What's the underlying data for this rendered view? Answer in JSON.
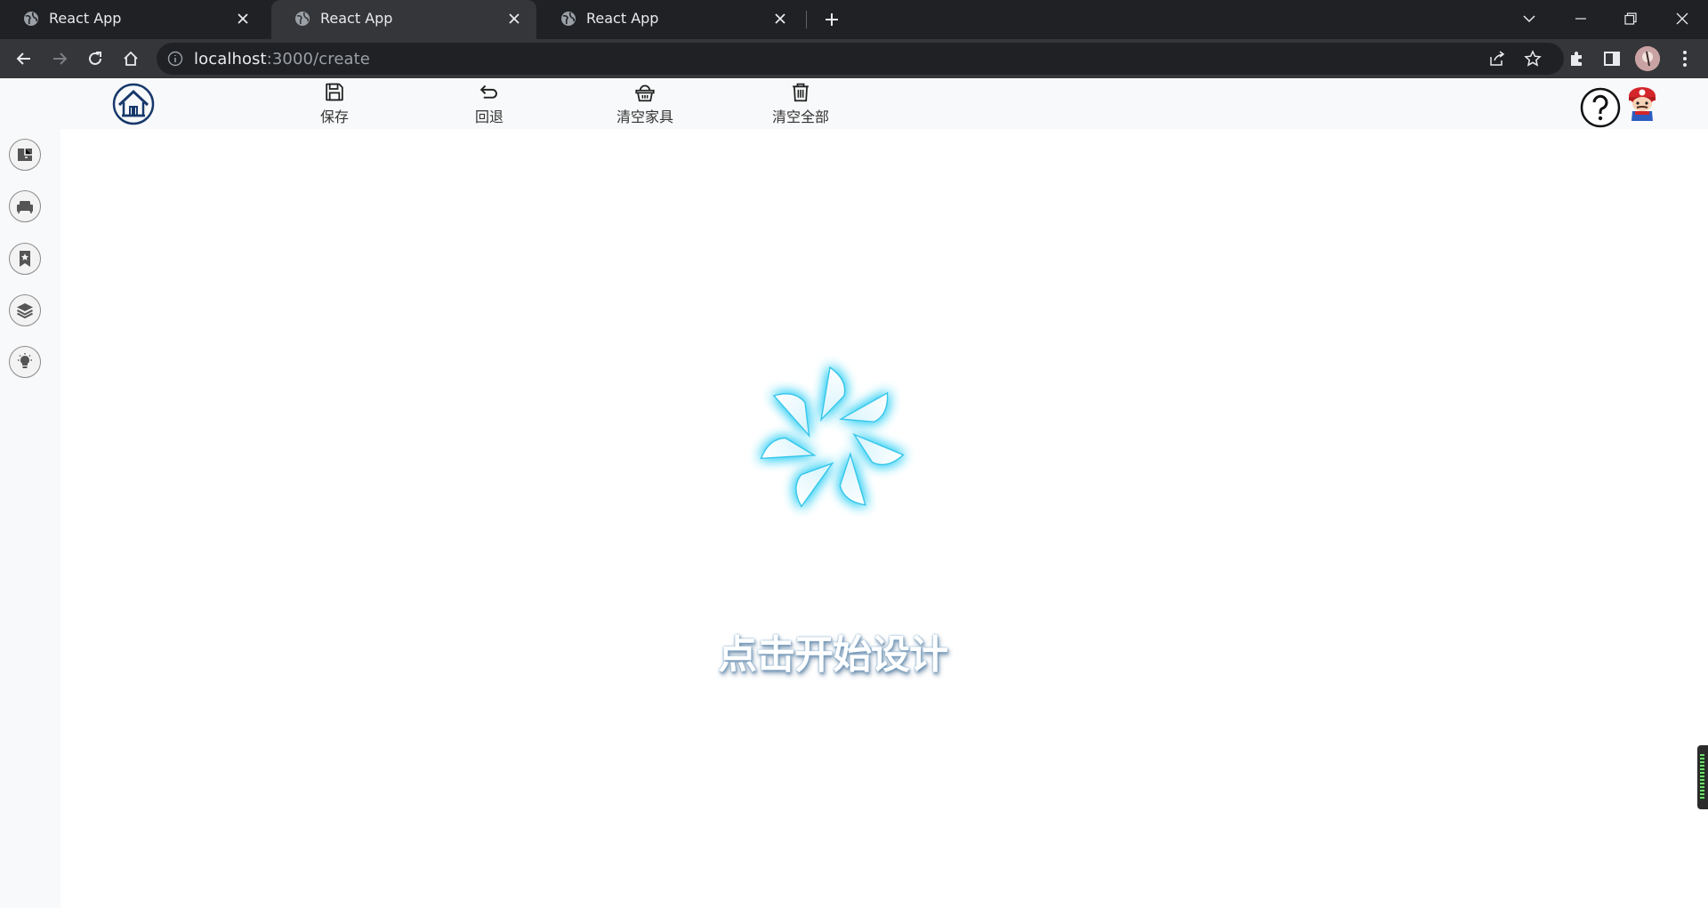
{
  "browser": {
    "tabs": [
      {
        "title": "React App",
        "active": false
      },
      {
        "title": "React App",
        "active": true
      },
      {
        "title": "React App",
        "active": false
      }
    ],
    "url_host": "localhost",
    "url_path": ":3000/create"
  },
  "header": {
    "tools": [
      {
        "label": "保存",
        "icon": "save-icon"
      },
      {
        "label": "回退",
        "icon": "undo-icon"
      },
      {
        "label": "清空家具",
        "icon": "basket-icon"
      },
      {
        "label": "清空全部",
        "icon": "trash-icon"
      }
    ]
  },
  "sidebar": {
    "items": [
      {
        "icon": "floorplan-icon"
      },
      {
        "icon": "sofa-icon"
      },
      {
        "icon": "bookmark-star-icon"
      },
      {
        "icon": "layers-icon"
      },
      {
        "icon": "lightbulb-icon"
      }
    ]
  },
  "main": {
    "start_label": "点击开始设计"
  },
  "colors": {
    "accent_glow": "#38d1f5",
    "logo_navy": "#17386b",
    "chrome_dark": "#202124",
    "chrome_tab": "#35363a"
  }
}
